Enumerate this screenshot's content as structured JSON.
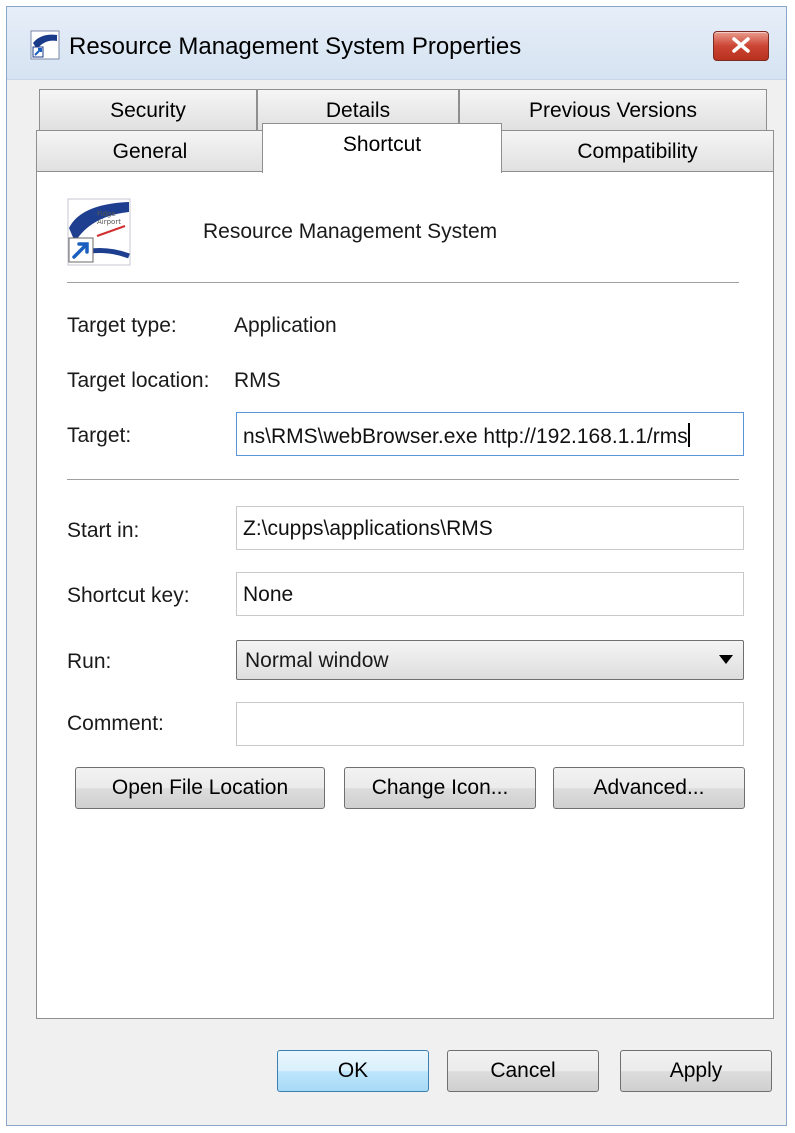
{
  "window": {
    "title": "Resource Management System Properties",
    "icon": "app-shortcut-icon",
    "close_icon": "close-icon"
  },
  "tabs": {
    "row1": [
      {
        "label": "Security"
      },
      {
        "label": "Details"
      },
      {
        "label": "Previous Versions"
      }
    ],
    "row2": [
      {
        "label": "General"
      },
      {
        "label": "Shortcut",
        "active": true
      },
      {
        "label": "Compatibility"
      }
    ]
  },
  "shortcut": {
    "name": "Resource Management System",
    "icon": "fidge-airport-shortcut-icon",
    "target_type_label": "Target type:",
    "target_type_value": "Application",
    "target_location_label": "Target location:",
    "target_location_value": "RMS",
    "target_label": "Target:",
    "target_value": "ns\\RMS\\webBrowser.exe http://192.168.1.1/rms",
    "start_in_label": "Start in:",
    "start_in_value": "Z:\\cupps\\applications\\RMS",
    "shortcut_key_label": "Shortcut key:",
    "shortcut_key_value": "None",
    "run_label": "Run:",
    "run_value": "Normal window",
    "comment_label": "Comment:",
    "comment_value": "",
    "open_file_location": "Open File Location",
    "change_icon": "Change Icon...",
    "advanced": "Advanced..."
  },
  "footer": {
    "ok": "OK",
    "cancel": "Cancel",
    "apply": "Apply"
  },
  "colors": {
    "close_button": "#cc4433",
    "focus_border": "#5b95d6",
    "default_button": "#a7d9f5"
  }
}
